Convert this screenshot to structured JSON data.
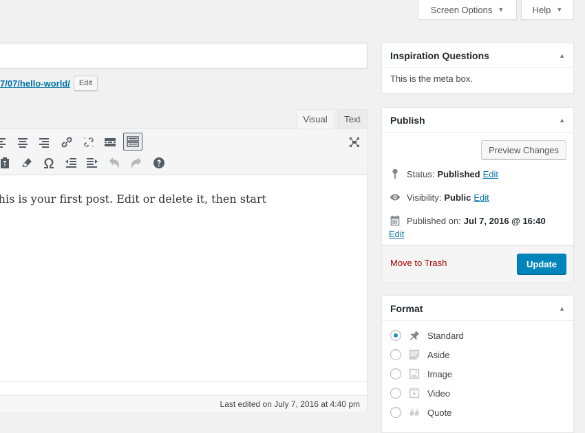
{
  "screen_meta": {
    "screen_options_label": "Screen Options",
    "help_label": "Help"
  },
  "post": {
    "permalink_text": "7/07/hello-world/",
    "permalink_edit_label": "Edit"
  },
  "editor": {
    "tabs": [
      {
        "label": "Visual",
        "active": true
      },
      {
        "label": "Text",
        "active": false
      }
    ],
    "toolbar_row1": [
      "align-left-icon",
      "align-center-icon",
      "align-right-icon",
      "link-icon",
      "unlink-icon",
      "read-more-icon",
      "toolbar-toggle-icon",
      "fullscreen-icon"
    ],
    "toolbar_row2": [
      "paste-text-icon",
      "clear-formatting-icon",
      "special-character-icon",
      "outdent-icon",
      "indent-icon",
      "undo-icon",
      "redo-icon",
      "help-icon"
    ],
    "content": "This is your first post. Edit or delete it, then start",
    "last_edited": "Last edited on July 7, 2016 at 4:40 pm"
  },
  "inspiration": {
    "title": "Inspiration Questions",
    "body": "This is the meta box."
  },
  "publish": {
    "title": "Publish",
    "preview_label": "Preview Changes",
    "status_label": "Status:",
    "status_value": "Published",
    "visibility_label": "Visibility:",
    "visibility_value": "Public",
    "published_on_label": "Published on:",
    "published_on_value": "Jul 7, 2016 @ 16:40",
    "edit_label": "Edit",
    "trash_label": "Move to Trash",
    "update_label": "Update"
  },
  "format": {
    "title": "Format",
    "options": [
      {
        "label": "Standard",
        "icon": "pin-icon",
        "checked": true
      },
      {
        "label": "Aside",
        "icon": "aside-icon",
        "checked": false
      },
      {
        "label": "Image",
        "icon": "image-icon",
        "checked": false
      },
      {
        "label": "Video",
        "icon": "video-icon",
        "checked": false
      },
      {
        "label": "Quote",
        "icon": "quote-icon",
        "checked": false
      }
    ]
  },
  "colors": {
    "primary": "#0085ba",
    "link": "#0073aa",
    "trash": "#aa0000"
  }
}
